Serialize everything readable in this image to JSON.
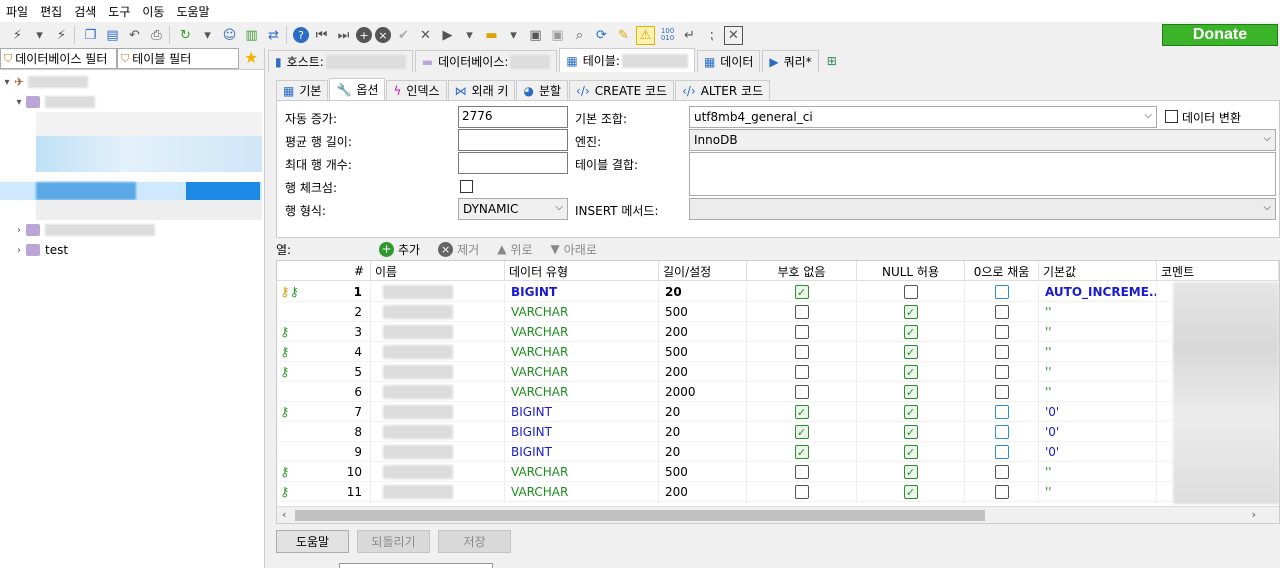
{
  "menu": [
    "파일",
    "편집",
    "검색",
    "도구",
    "이동",
    "도움말"
  ],
  "donate_label": "Donate",
  "filters": {
    "db_filter": "데이터베이스 필터",
    "table_filter": "테이블 필터"
  },
  "tree": {
    "test_label": "test"
  },
  "top_tabs": [
    {
      "label": "호스트:"
    },
    {
      "label": "데이터베이스:"
    },
    {
      "label": "테이블:"
    },
    {
      "label": "데이터"
    },
    {
      "label": "쿼리*"
    }
  ],
  "sub_tabs": [
    "기본",
    "옵션",
    "인덱스",
    "외래 키",
    "분할",
    "CREATE 코드",
    "ALTER 코드"
  ],
  "options": {
    "auto_increment_label": "자동 증가:",
    "auto_increment_value": "2776",
    "avg_row_len_label": "평균 행 길이:",
    "max_rows_label": "최대 행 개수:",
    "checksum_label": "행 체크섬:",
    "row_format_label": "행 형식:",
    "row_format_value": "DYNAMIC",
    "collation_label": "기본 조합:",
    "collation_value": "utf8mb4_general_ci",
    "convert_label": "데이터 변환",
    "engine_label": "엔진:",
    "engine_value": "InnoDB",
    "union_label": "테이블 결합:",
    "insert_method_label": "INSERT 메서드:"
  },
  "columns_bar": {
    "label": "열:",
    "add": "추가",
    "remove": "제거",
    "up": "위로",
    "down": "아래로"
  },
  "grid": {
    "headers": [
      "#",
      "이름",
      "데이터 유형",
      "길이/설정",
      "부호 없음",
      "NULL 허용",
      "0으로 채움",
      "기본값",
      "코멘트"
    ],
    "rows": [
      {
        "n": "1",
        "type": "BIGINT",
        "len": "20",
        "def": "AUTO_INCREME...",
        "unsigned": true,
        "nullable": false,
        "zerofill": false,
        "keys": "pk"
      },
      {
        "n": "2",
        "type": "VARCHAR",
        "len": "500",
        "def": "''",
        "unsigned": false,
        "nullable": true,
        "zerofill": false,
        "keys": ""
      },
      {
        "n": "3",
        "type": "VARCHAR",
        "len": "200",
        "def": "''",
        "unsigned": false,
        "nullable": true,
        "zerofill": false,
        "keys": "idx"
      },
      {
        "n": "4",
        "type": "VARCHAR",
        "len": "500",
        "def": "''",
        "unsigned": false,
        "nullable": true,
        "zerofill": false,
        "keys": "idx"
      },
      {
        "n": "5",
        "type": "VARCHAR",
        "len": "200",
        "def": "''",
        "unsigned": false,
        "nullable": true,
        "zerofill": false,
        "keys": "idx"
      },
      {
        "n": "6",
        "type": "VARCHAR",
        "len": "2000",
        "def": "''",
        "unsigned": false,
        "nullable": true,
        "zerofill": false,
        "keys": ""
      },
      {
        "n": "7",
        "type": "BIGINT",
        "len": "20",
        "def": "'0'",
        "unsigned": true,
        "nullable": true,
        "zerofill": false,
        "keys": "idx"
      },
      {
        "n": "8",
        "type": "BIGINT",
        "len": "20",
        "def": "'0'",
        "unsigned": true,
        "nullable": true,
        "zerofill": false,
        "keys": ""
      },
      {
        "n": "9",
        "type": "BIGINT",
        "len": "20",
        "def": "'0'",
        "unsigned": true,
        "nullable": true,
        "zerofill": false,
        "keys": ""
      },
      {
        "n": "10",
        "type": "VARCHAR",
        "len": "500",
        "def": "''",
        "unsigned": false,
        "nullable": true,
        "zerofill": false,
        "keys": "idx"
      },
      {
        "n": "11",
        "type": "VARCHAR",
        "len": "200",
        "def": "''",
        "unsigned": false,
        "nullable": true,
        "zerofill": false,
        "keys": "idx"
      }
    ]
  },
  "buttons": {
    "help": "도움말",
    "discard": "되돌리기",
    "save": "저장"
  },
  "colors": {
    "donate": "#3bb42a",
    "bigint": "#1a1acf",
    "varchar": "#1d8d1d"
  }
}
